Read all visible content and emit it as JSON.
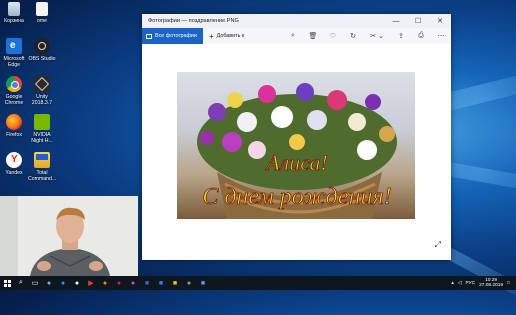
{
  "desktop": {
    "icons": [
      {
        "label": "Корзина",
        "name": "recycle-bin"
      },
      {
        "label": "ome",
        "name": "folder"
      },
      {
        "label": "Microsoft\nEdge",
        "name": "edge"
      },
      {
        "label": "OBS Studio",
        "name": "obs"
      },
      {
        "label": "Google\nChrome",
        "name": "chrome"
      },
      {
        "label": "Unity\n2018.3.7",
        "name": "unity"
      },
      {
        "label": "Firefox",
        "name": "firefox"
      },
      {
        "label": "NVIDIA\nNight H...",
        "name": "nvidia"
      },
      {
        "label": "Yandex",
        "name": "yandex"
      },
      {
        "label": "Total\nCommand...",
        "name": "total-commander"
      }
    ]
  },
  "photos_window": {
    "title": "Фотографии — поздравление.PNG",
    "controls": {
      "minimize": "—",
      "maximize": "☐",
      "close": "✕"
    },
    "toolbar": {
      "all_photos": "Все фотографии",
      "add_to": "Добавить к",
      "icons": [
        "zoom-icon",
        "delete-icon",
        "favorite-icon",
        "rotate-icon",
        "crop-icon",
        "share-icon",
        "print-icon",
        "more-icon"
      ]
    },
    "image": {
      "line1": "Алиса!",
      "line2": "С днем рождения!"
    }
  },
  "taskbar": {
    "time": "10:29",
    "date": "27.08.2019",
    "lang": "РУС"
  }
}
